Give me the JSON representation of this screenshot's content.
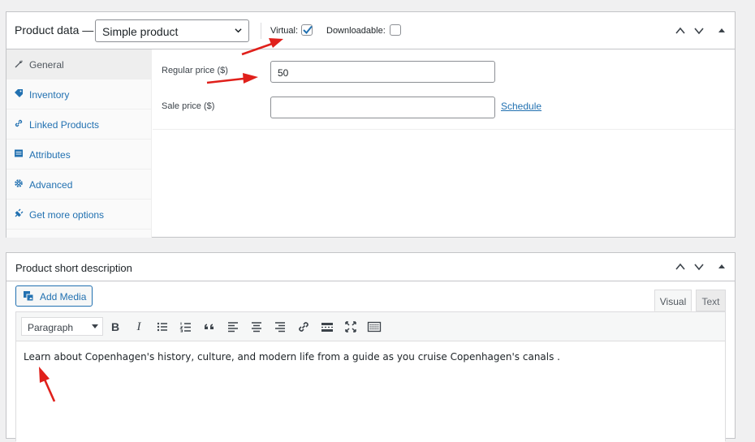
{
  "product_data": {
    "title": "Product data —",
    "type_select": {
      "value": "Simple product"
    },
    "virtual": {
      "label": "Virtual:",
      "checked": true
    },
    "downloadable": {
      "label": "Downloadable:",
      "checked": false
    },
    "tabs": [
      {
        "label": "General",
        "icon": "wrench-icon",
        "active": true
      },
      {
        "label": "Inventory",
        "icon": "tag-icon",
        "active": false
      },
      {
        "label": "Linked Products",
        "icon": "link-icon",
        "active": false
      },
      {
        "label": "Attributes",
        "icon": "table-icon",
        "active": false
      },
      {
        "label": "Advanced",
        "icon": "gear-icon",
        "active": false
      },
      {
        "label": "Get more options",
        "icon": "plugin-icon",
        "active": false
      }
    ],
    "regular_price": {
      "label": "Regular price ($)",
      "value": "50"
    },
    "sale_price": {
      "label": "Sale price ($)",
      "value": ""
    },
    "schedule_link": "Schedule"
  },
  "short_description": {
    "title": "Product short description",
    "add_media_label": "Add Media",
    "editor_tabs": {
      "visual": "Visual",
      "text": "Text"
    },
    "format_select": "Paragraph",
    "toolbar": {
      "bold": "B",
      "italic": "I",
      "buttons": [
        "bulleted-list-icon",
        "numbered-list-icon",
        "blockquote-icon",
        "align-left-icon",
        "align-center-icon",
        "align-right-icon",
        "link-icon",
        "read-more-icon",
        "fullscreen-icon",
        "toolbar-toggle-icon"
      ]
    },
    "content": "Learn about Copenhagen's history, culture, and modern life from a guide as you cruise Copenhagen's canals ."
  },
  "colors": {
    "link": "#2271b1",
    "annotation_arrow": "#e0201b",
    "border": "#c3c4c7",
    "checkbox_check": "#2271b1"
  }
}
